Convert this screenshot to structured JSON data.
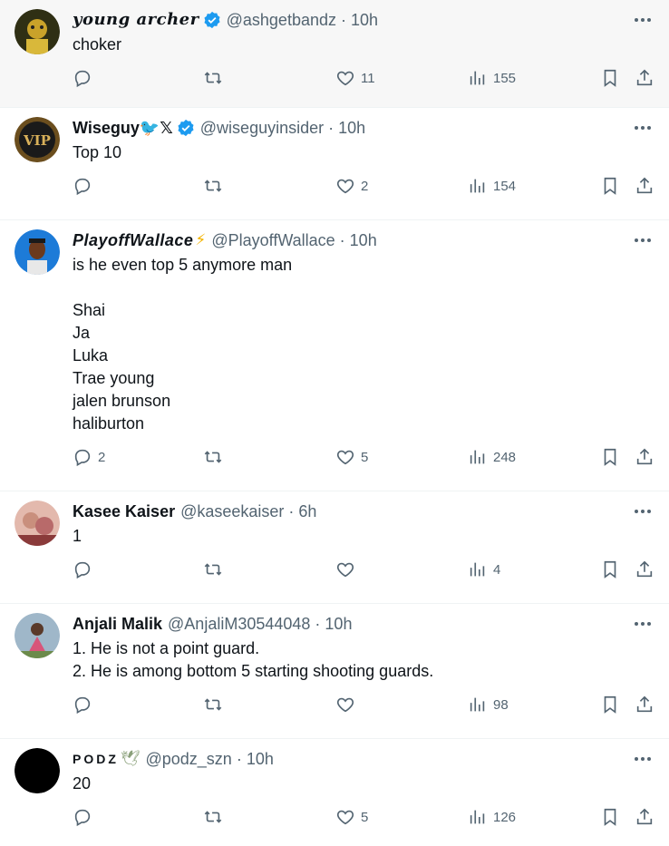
{
  "tweets": [
    {
      "name": "young archer",
      "verified": true,
      "handle": "@ashgetbandz",
      "time": "10h",
      "lines": [
        "choker"
      ],
      "replies": "",
      "likes": "11",
      "views": "155",
      "avatar_color": "#3a3a1a"
    },
    {
      "name": "Wiseguy🐦𝕏",
      "verified": true,
      "handle": "@wiseguyinsider",
      "time": "10h",
      "lines": [
        "Top 10"
      ],
      "replies": "",
      "likes": "2",
      "views": "154",
      "avatar_color": "#1a1a1a",
      "avatar_text": "VIP"
    },
    {
      "name": "PlayoffWallace",
      "emoji": "⚡",
      "handle": "@PlayoffWallace",
      "time": "10h",
      "lines": [
        "is he even top 5 anymore man",
        "",
        "Shai",
        "Ja",
        "Luka",
        "Trae young",
        "jalen brunson",
        "haliburton"
      ],
      "replies": "2",
      "likes": "5",
      "views": "248",
      "avatar_color": "#1d7bd8"
    },
    {
      "name": "Kasee Kaiser",
      "handle": "@kaseekaiser",
      "time": "6h",
      "lines": [
        "1"
      ],
      "replies": "",
      "likes": "",
      "views": "4",
      "avatar_color": "#d9a7a0"
    },
    {
      "name": "Anjali Malik",
      "handle": "@AnjaliM30544048",
      "time": "10h",
      "lines": [
        "1. He is not a point guard.",
        "2. He is among bottom 5 starting shooting guards."
      ],
      "replies": "",
      "likes": "",
      "views": "98",
      "avatar_color": "#c97b8a"
    },
    {
      "name": "PODZ",
      "emoji": "🕊",
      "handle": "@podz_szn",
      "time": "10h",
      "lines": [
        "20"
      ],
      "replies": "",
      "likes": "5",
      "views": "126",
      "avatar_color": "#000000"
    }
  ],
  "colors": {
    "text": "#0f1419",
    "secondary": "#536471",
    "verified": "#1d9bf0",
    "highlight_bg": "#f7f7f7"
  },
  "icons": [
    "reply-icon",
    "retweet-icon",
    "like-icon",
    "views-icon",
    "bookmark-icon",
    "share-icon",
    "more-icon",
    "verified-badge-icon"
  ]
}
